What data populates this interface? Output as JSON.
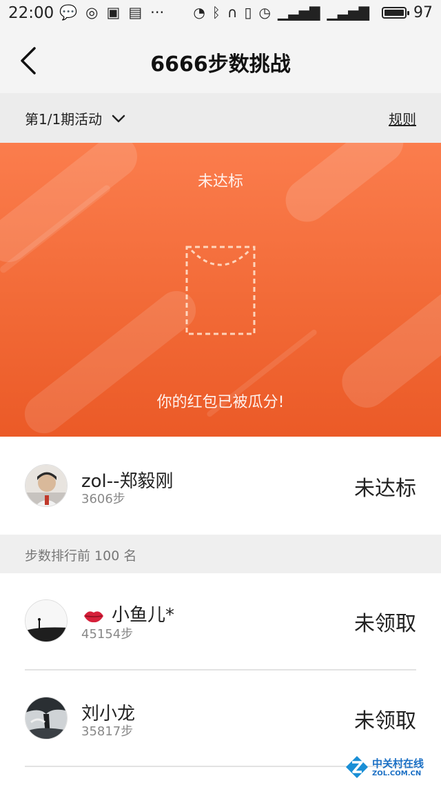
{
  "status_bar": {
    "time": "22:00",
    "battery": "97",
    "icons_left": [
      "chat-bubble-icon",
      "weibo-icon",
      "weibo-alt-icon",
      "news-icon",
      "more-icon"
    ],
    "icons_right": [
      "hotspot-icon",
      "bluetooth-icon",
      "headset-icon",
      "vibrate-icon",
      "alarm-icon",
      "signal-4g-icon",
      "signal-icon"
    ]
  },
  "header": {
    "title": "6666步数挑战"
  },
  "period_bar": {
    "period_label": "第1/1期活动",
    "rules_label": "规则"
  },
  "banner": {
    "status": "未达标",
    "message": "你的红包已被瓜分!",
    "colors": {
      "top": "#fb7d4d",
      "bottom": "#eb5a27"
    }
  },
  "me": {
    "name": "zol--郑毅刚",
    "steps": "3606步",
    "state": "未达标"
  },
  "ranking": {
    "heading": "步数排行前 100 名",
    "items": [
      {
        "name": "小鱼儿*",
        "steps": "45154步",
        "state": "未领取",
        "emoji": "lips"
      },
      {
        "name": "刘小龙",
        "steps": "35817步",
        "state": "未领取"
      }
    ]
  },
  "watermark": {
    "title": "中关村在线",
    "subtitle": "ZOL.COM.CN"
  }
}
